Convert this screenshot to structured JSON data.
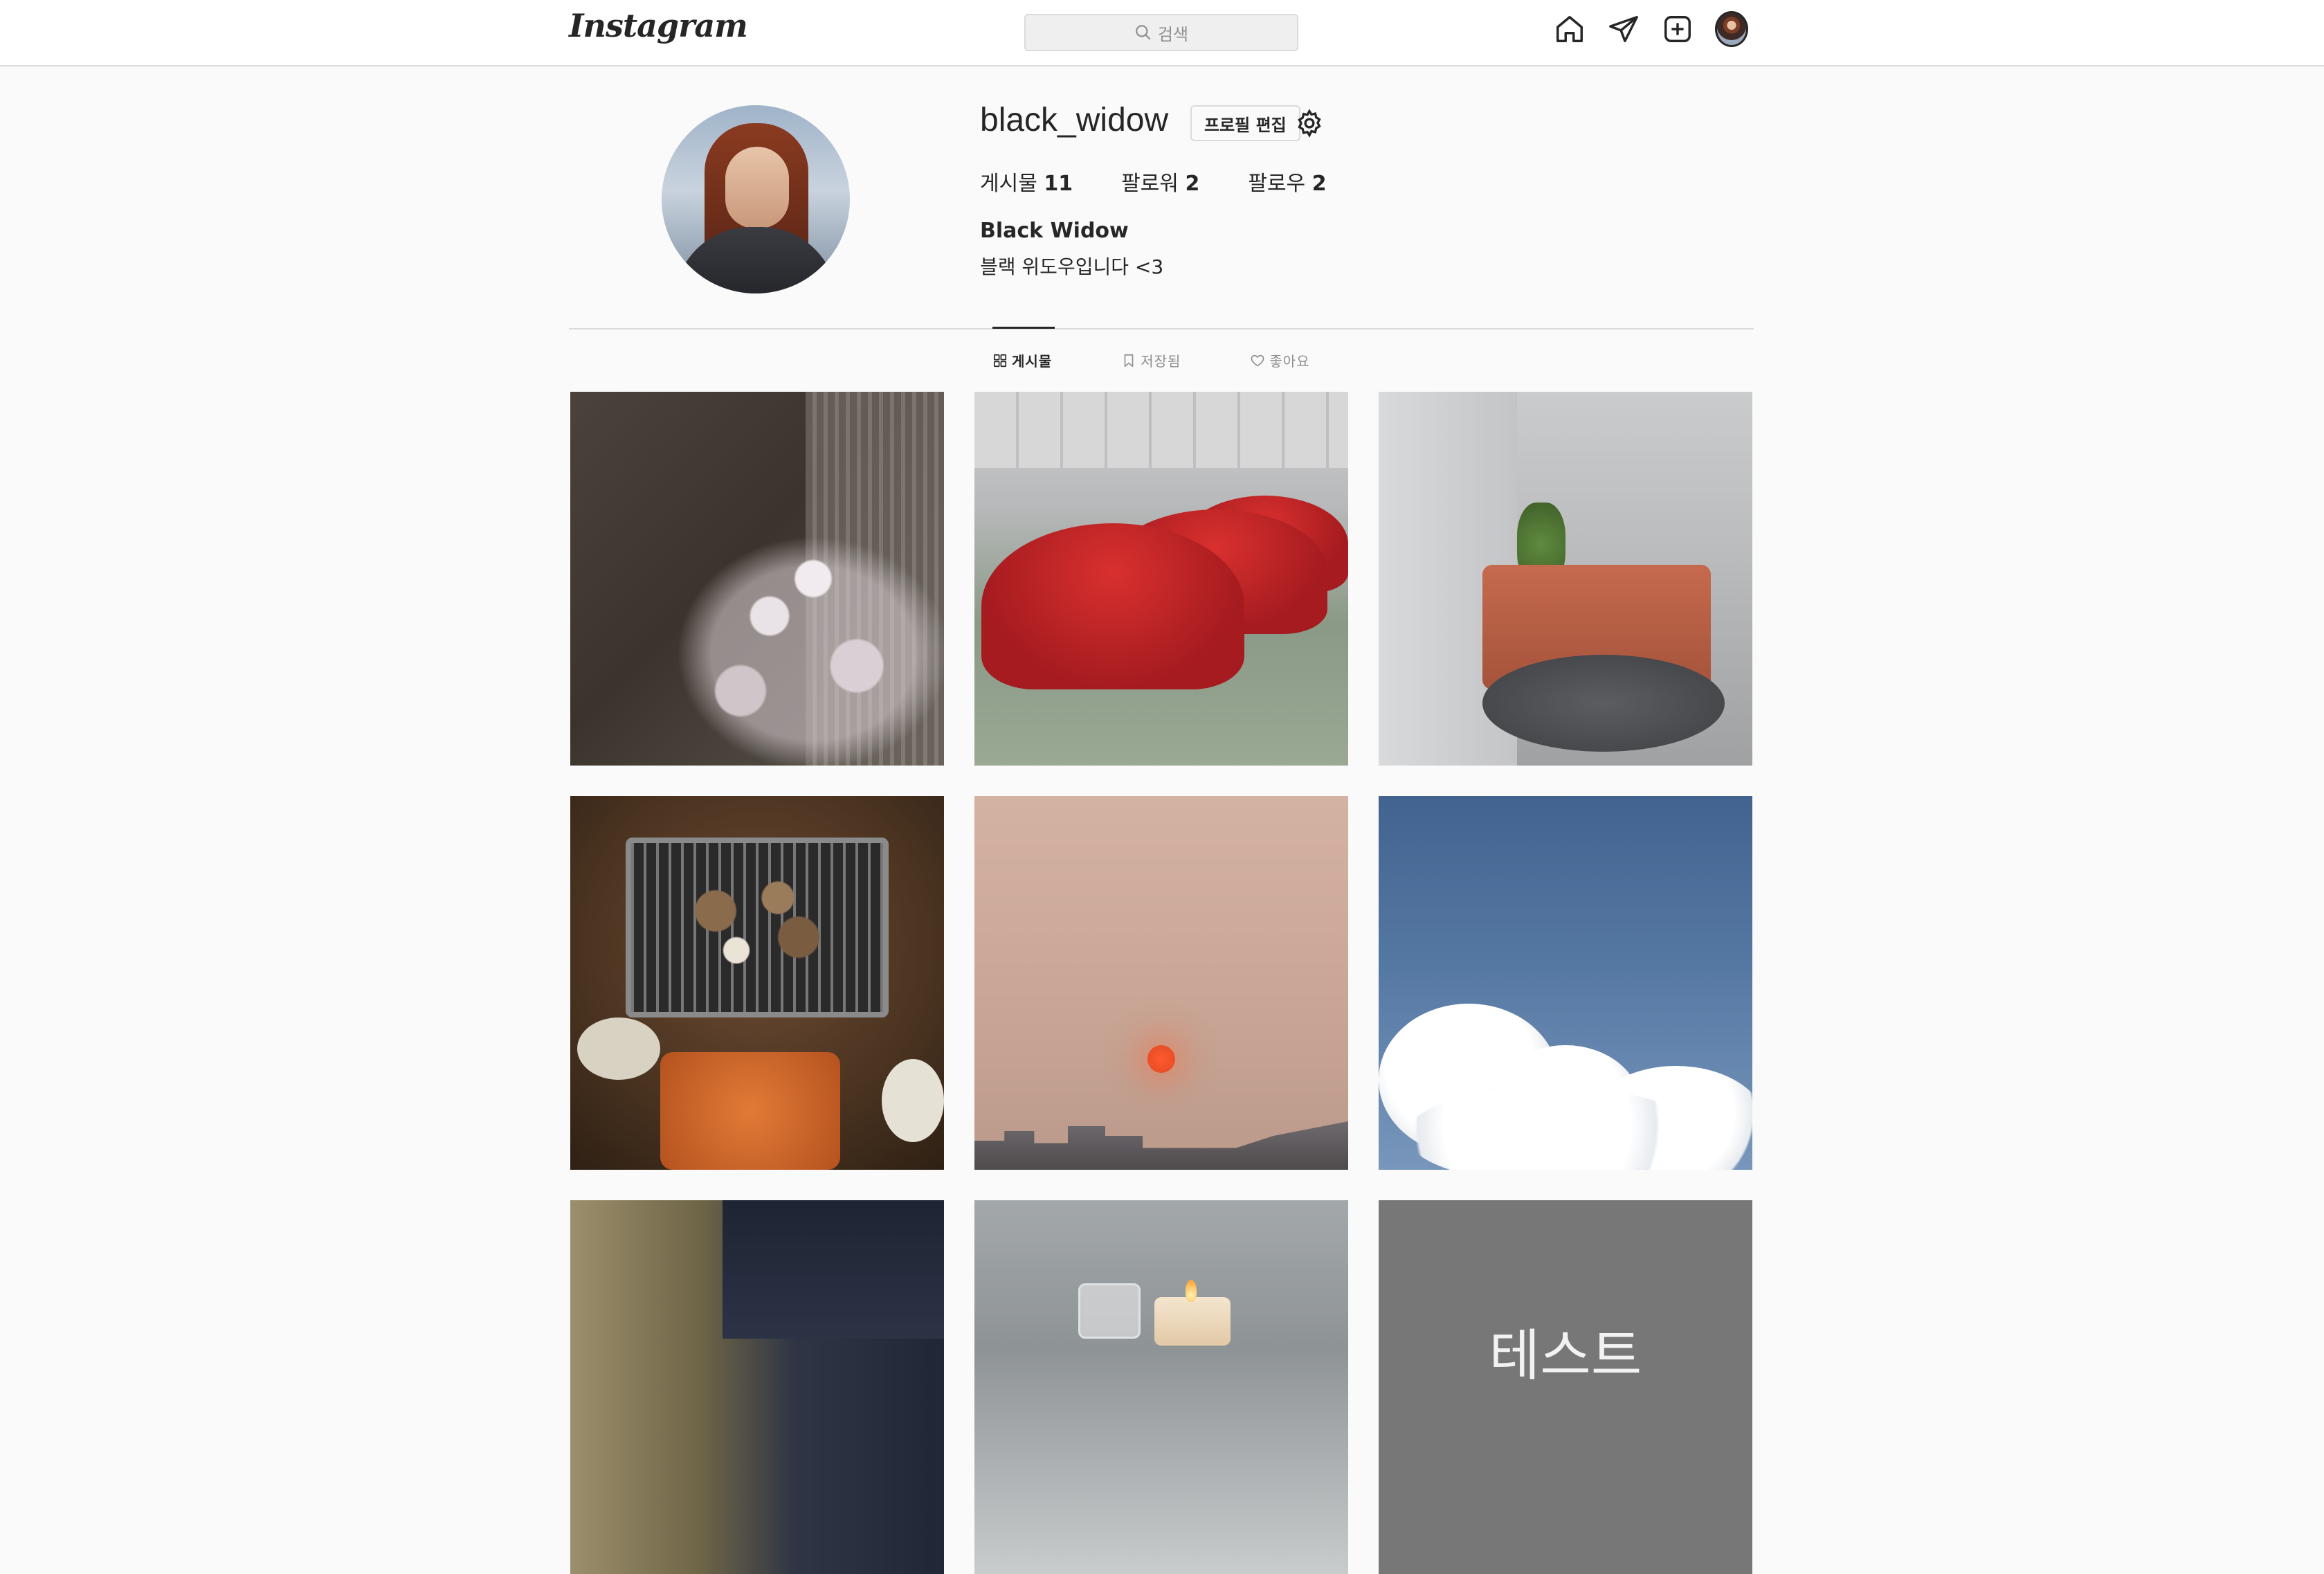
{
  "header": {
    "logo_text": "Instagram",
    "search_placeholder": "검색",
    "icons": [
      "home-icon",
      "direct-message-icon",
      "new-post-icon",
      "profile-avatar-icon"
    ]
  },
  "profile": {
    "username": "black_widow",
    "edit_button_label": "프로필 편집",
    "stats": [
      {
        "label": "게시물",
        "value": "11"
      },
      {
        "label": "팔로워",
        "value": "2"
      },
      {
        "label": "팔로우",
        "value": "2"
      }
    ],
    "full_name": "Black Widow",
    "bio": "블랙 위도우입니다 <3"
  },
  "tabs": [
    {
      "label": "게시물",
      "icon": "grid-icon",
      "active": true
    },
    {
      "label": "저장됨",
      "icon": "bookmark-icon",
      "active": false
    },
    {
      "label": "좋아요",
      "icon": "heart-icon",
      "active": false
    }
  ],
  "posts": [
    {
      "subject": "night-cherry-blossoms"
    },
    {
      "subject": "covered-red-cars"
    },
    {
      "subject": "lounge-chairs"
    },
    {
      "subject": "korean-bbq"
    },
    {
      "subject": "hazy-sunset"
    },
    {
      "subject": "blue-sky-clouds"
    },
    {
      "subject": "room-at-dusk"
    },
    {
      "subject": "candle"
    },
    {
      "subject": "text-card",
      "text": "테스트"
    }
  ],
  "colors": {
    "background": "#fafafa",
    "border": "#dbdbdb",
    "text": "#262626",
    "muted": "#8e8e8e"
  }
}
